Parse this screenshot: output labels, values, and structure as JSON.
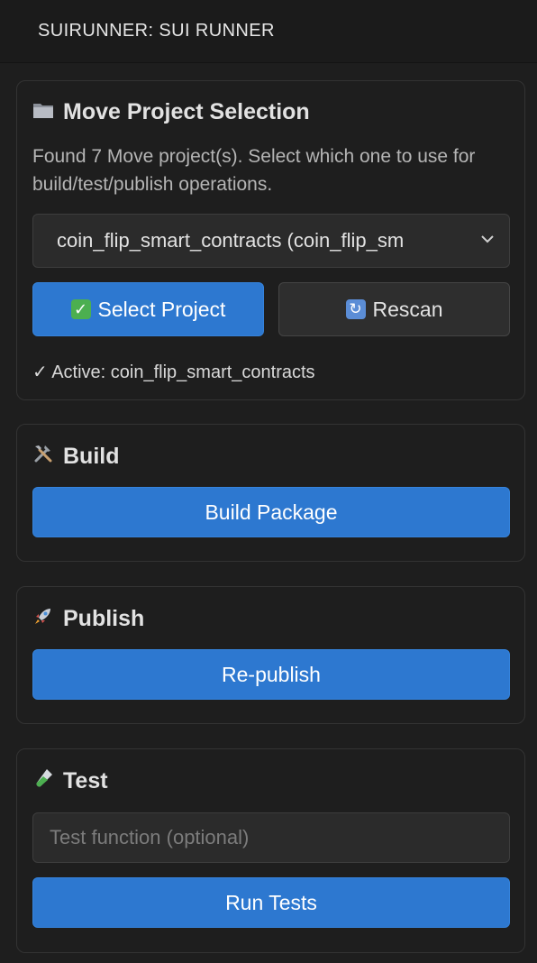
{
  "header": {
    "title": "SUIRUNNER: SUI RUNNER"
  },
  "project_section": {
    "icon": "folder-icon",
    "title": "Move Project Selection",
    "description": "Found 7 Move project(s). Select which one to use for build/test/publish operations.",
    "selected_project": "coin_flip_smart_contracts (coin_flip_sm",
    "select_button_label": "Select Project",
    "select_button_icon": "check-mark-icon",
    "rescan_button_label": "Rescan",
    "rescan_button_icon": "refresh-icon",
    "active_text": "✓ Active: coin_flip_smart_contracts"
  },
  "build_section": {
    "icon": "tools-icon",
    "title": "Build",
    "button_label": "Build Package"
  },
  "publish_section": {
    "icon": "rocket-icon",
    "title": "Publish",
    "button_label": "Re-publish"
  },
  "test_section": {
    "icon": "test-tube-icon",
    "title": "Test",
    "input_placeholder": "Test function (optional)",
    "input_value": "",
    "button_label": "Run Tests"
  },
  "colors": {
    "primary_button": "#2d78d0",
    "background": "#1e1e1e",
    "panel_border": "#333333"
  }
}
